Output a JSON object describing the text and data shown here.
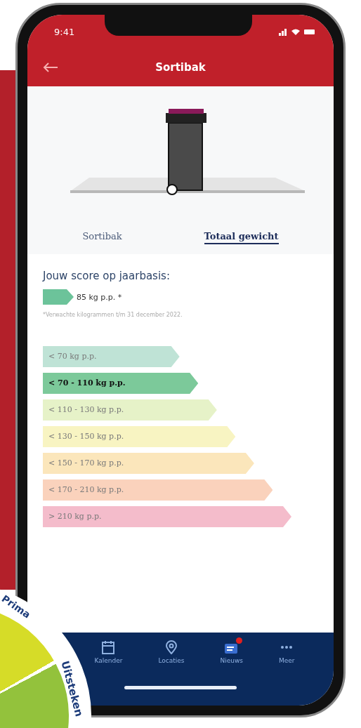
{
  "status_bar": {
    "time": "9:41"
  },
  "header": {
    "title": "Sortibak"
  },
  "tabs": [
    {
      "label": "Sortibak",
      "selected": false
    },
    {
      "label": "Totaal gewicht",
      "selected": true
    }
  ],
  "score": {
    "heading": "Jouw score op jaarbasis:",
    "value": "85 kg p.p. *",
    "color": "#6cc39a",
    "footnote": "*Verwachte kilogrammen t/m 31 december 2022."
  },
  "scale": [
    {
      "label": "< 70 kg p.p.",
      "color": "#bfe3d6",
      "selected": false
    },
    {
      "label": "< 70 - 110 kg p.p.",
      "color": "#7cc99a",
      "selected": true
    },
    {
      "label": "< 110 - 130 kg p.p.",
      "color": "#e6f2c8",
      "selected": false
    },
    {
      "label": "< 130 - 150 kg p.p.",
      "color": "#f8f4c2",
      "selected": false
    },
    {
      "label": "< 150 - 170 kg p.p.",
      "color": "#fbe6bb",
      "selected": false
    },
    {
      "label": "< 170 - 210 kg p.p.",
      "color": "#fad2bc",
      "selected": false
    },
    {
      "label": "> 210 kg p.p.",
      "color": "#f4bccb",
      "selected": false
    }
  ],
  "nav": [
    {
      "label": "Kalender",
      "kind": "calendar",
      "badge": false
    },
    {
      "label": "Locaties",
      "kind": "pin",
      "badge": false
    },
    {
      "label": "Nieuws",
      "kind": "news",
      "badge": true
    },
    {
      "label": "Meer",
      "kind": "more",
      "badge": false
    }
  ],
  "badge_graphic": {
    "labels": [
      "Prima",
      "Uitsteken"
    ]
  }
}
